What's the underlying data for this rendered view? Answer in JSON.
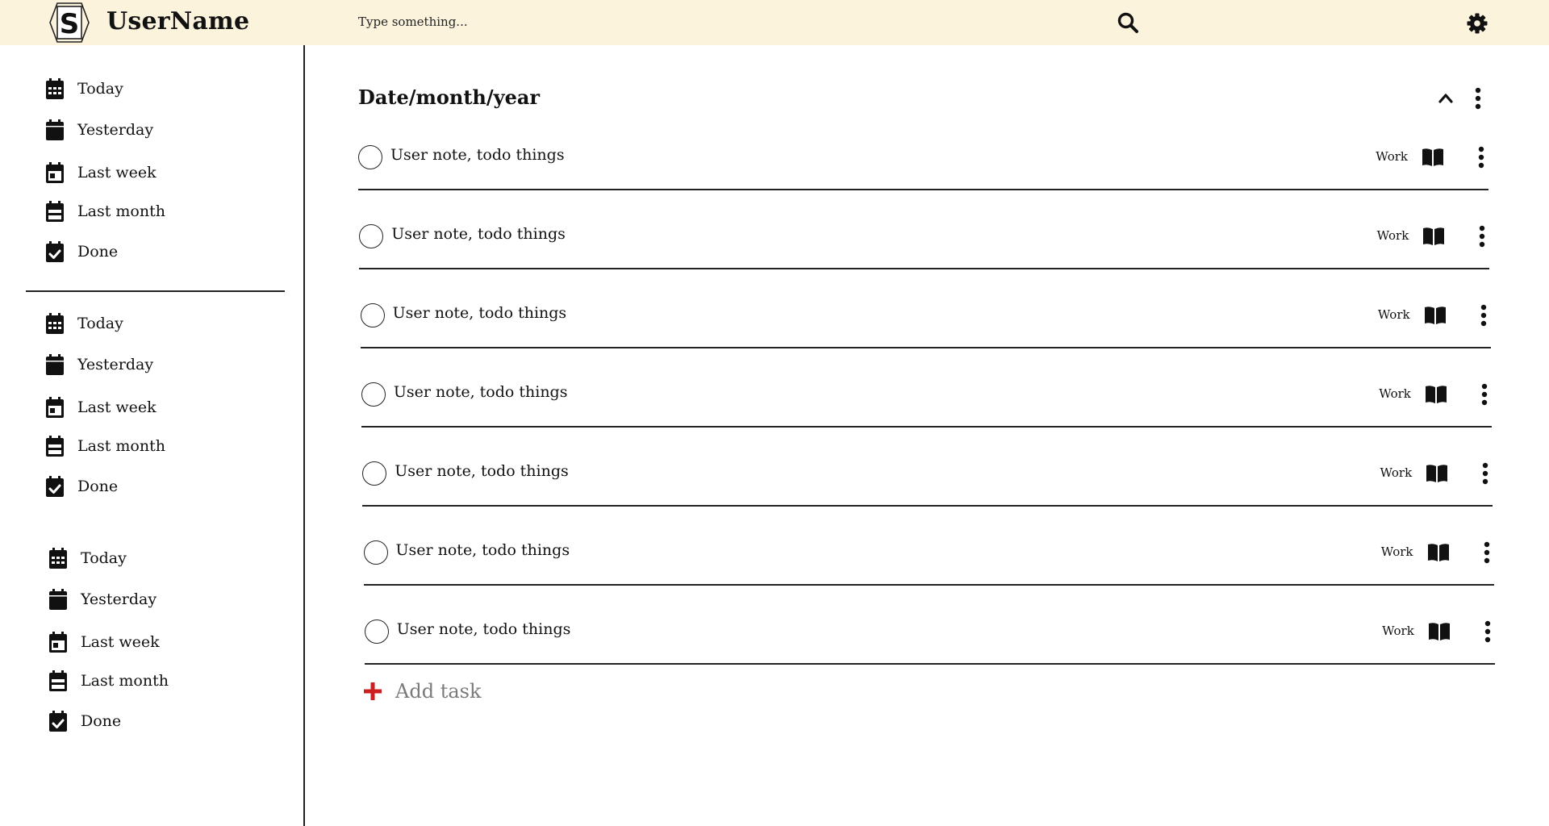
{
  "header": {
    "username": "UserName",
    "search_placeholder": "Type something...",
    "logo_icon": "s-hexagon-logo",
    "search_icon": "search-icon",
    "settings_icon": "gear-icon",
    "background_color": "#fcf3dd"
  },
  "sidebar": {
    "groups": [
      {
        "items": [
          {
            "label": "Today",
            "icon": "calendar-days-icon"
          },
          {
            "label": "Yesterday",
            "icon": "calendar-icon"
          },
          {
            "label": "Last week",
            "icon": "calendar-week-icon"
          },
          {
            "label": "Last month",
            "icon": "calendar-minus-icon"
          },
          {
            "label": "Done",
            "icon": "calendar-check-icon"
          }
        ]
      },
      {
        "items": [
          {
            "label": "Today",
            "icon": "calendar-days-icon"
          },
          {
            "label": "Yesterday",
            "icon": "calendar-icon"
          },
          {
            "label": "Last week",
            "icon": "calendar-week-icon"
          },
          {
            "label": "Last month",
            "icon": "calendar-minus-icon"
          },
          {
            "label": "Done",
            "icon": "calendar-check-icon"
          }
        ]
      },
      {
        "items": [
          {
            "label": "Today",
            "icon": "calendar-days-icon"
          },
          {
            "label": "Yesterday",
            "icon": "calendar-icon"
          },
          {
            "label": "Last week",
            "icon": "calendar-week-icon"
          },
          {
            "label": "Last month",
            "icon": "calendar-minus-icon"
          },
          {
            "label": "Done",
            "icon": "calendar-check-icon"
          }
        ]
      }
    ]
  },
  "main": {
    "group_title": "Date/month/year",
    "tasks": [
      {
        "text": "User note, todo things",
        "tag": "Work"
      },
      {
        "text": "User note, todo things",
        "tag": "Work"
      },
      {
        "text": "User note, todo things",
        "tag": "Work"
      },
      {
        "text": "User note, todo things",
        "tag": "Work"
      },
      {
        "text": "User note, todo things",
        "tag": "Work"
      },
      {
        "text": "User note, todo things",
        "tag": "Work"
      },
      {
        "text": "User note, todo things",
        "tag": "Work"
      }
    ],
    "add_task_label": "Add task",
    "add_color": "#cc1f1f"
  }
}
